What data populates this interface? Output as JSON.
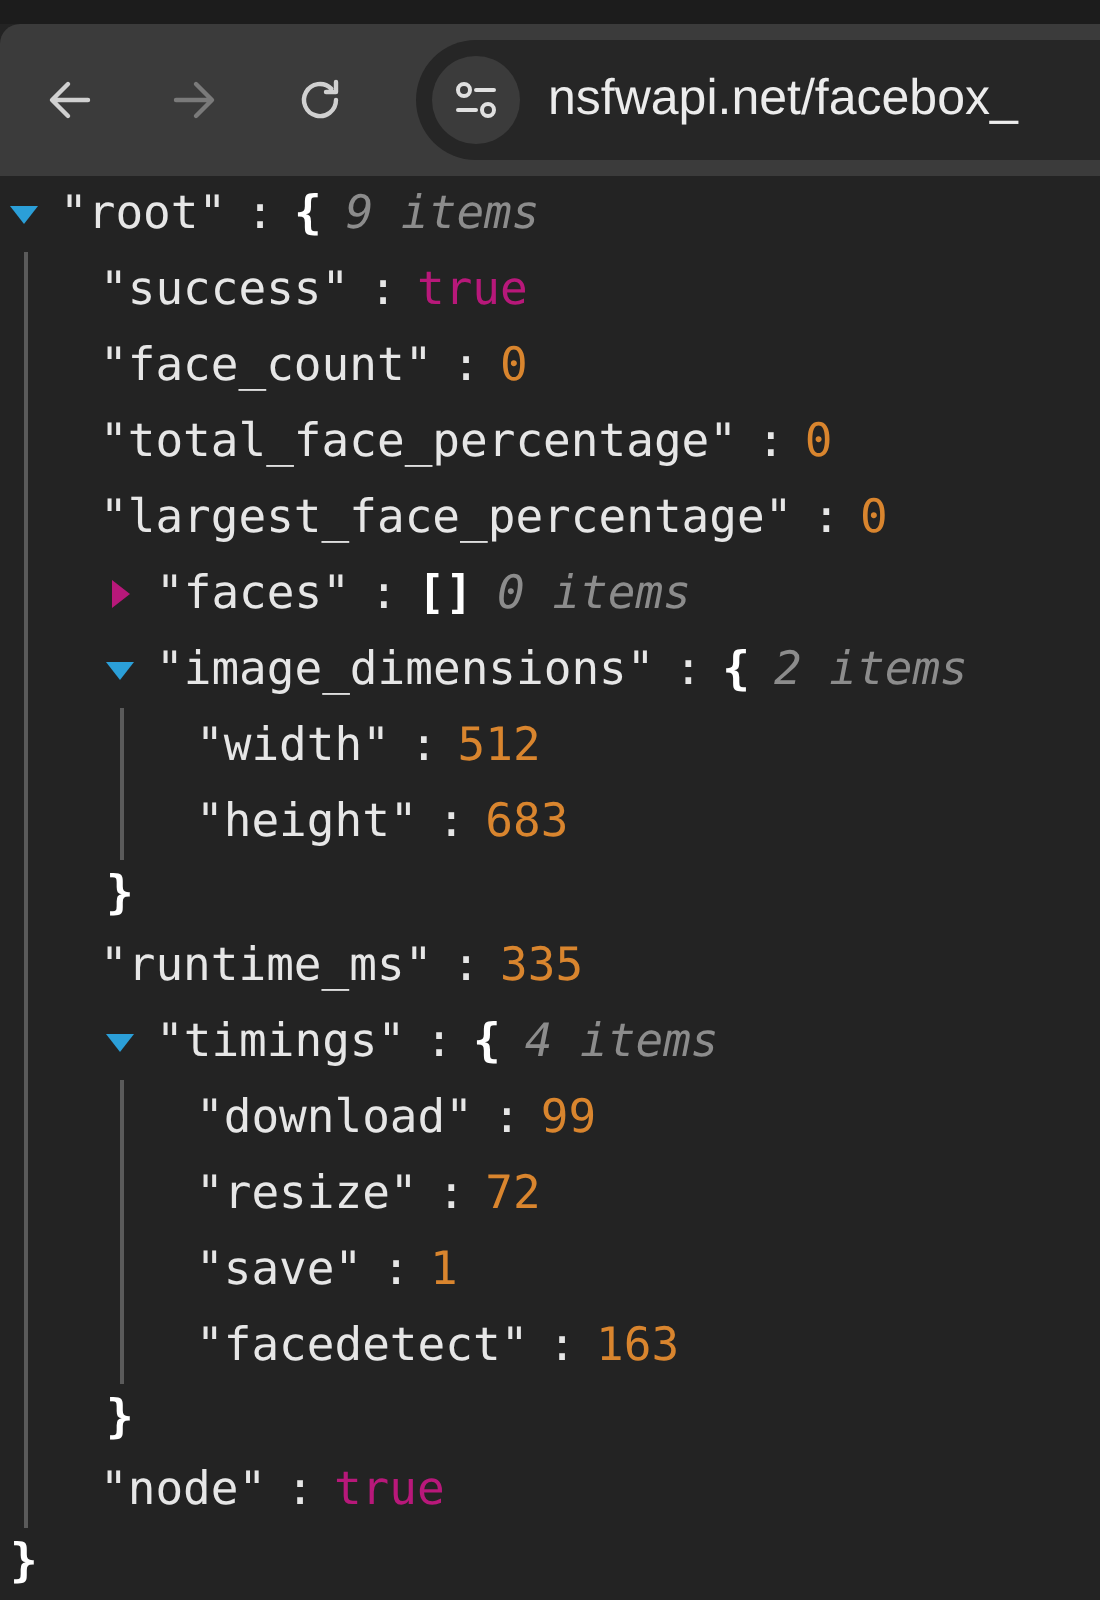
{
  "toolbar": {
    "url": "nsfwapi.net/facebox_"
  },
  "tree": {
    "kind": "object",
    "key": "\"root\"",
    "sep": ":",
    "open": "{",
    "count": "9 items",
    "expanded": true,
    "close": "}",
    "children": [
      {
        "kind": "boolean",
        "key": "\"success\"",
        "sep": ":",
        "value": "true"
      },
      {
        "kind": "number",
        "key": "\"face_count\"",
        "sep": ":",
        "value": "0"
      },
      {
        "kind": "number",
        "key": "\"total_face_percentage\"",
        "sep": ":",
        "value": "0"
      },
      {
        "kind": "number",
        "key": "\"largest_face_percentage\"",
        "sep": ":",
        "value": "0"
      },
      {
        "kind": "array",
        "key": "\"faces\"",
        "sep": ":",
        "open": "[]",
        "count": "0 items",
        "expanded": false
      },
      {
        "kind": "object",
        "key": "\"image_dimensions\"",
        "sep": ":",
        "open": "{",
        "count": "2 items",
        "expanded": true,
        "close": "}",
        "children": [
          {
            "kind": "number",
            "key": "\"width\"",
            "sep": ":",
            "value": "512"
          },
          {
            "kind": "number",
            "key": "\"height\"",
            "sep": ":",
            "value": "683"
          }
        ]
      },
      {
        "kind": "number",
        "key": "\"runtime_ms\"",
        "sep": ":",
        "value": "335"
      },
      {
        "kind": "object",
        "key": "\"timings\"",
        "sep": ":",
        "open": "{",
        "count": "4 items",
        "expanded": true,
        "close": "}",
        "children": [
          {
            "kind": "number",
            "key": "\"download\"",
            "sep": ":",
            "value": "99"
          },
          {
            "kind": "number",
            "key": "\"resize\"",
            "sep": ":",
            "value": "72"
          },
          {
            "kind": "number",
            "key": "\"save\"",
            "sep": ":",
            "value": "1"
          },
          {
            "kind": "number",
            "key": "\"facedetect\"",
            "sep": ":",
            "value": "163"
          }
        ]
      },
      {
        "kind": "boolean",
        "key": "\"node\"",
        "sep": ":",
        "value": "true"
      }
    ]
  }
}
